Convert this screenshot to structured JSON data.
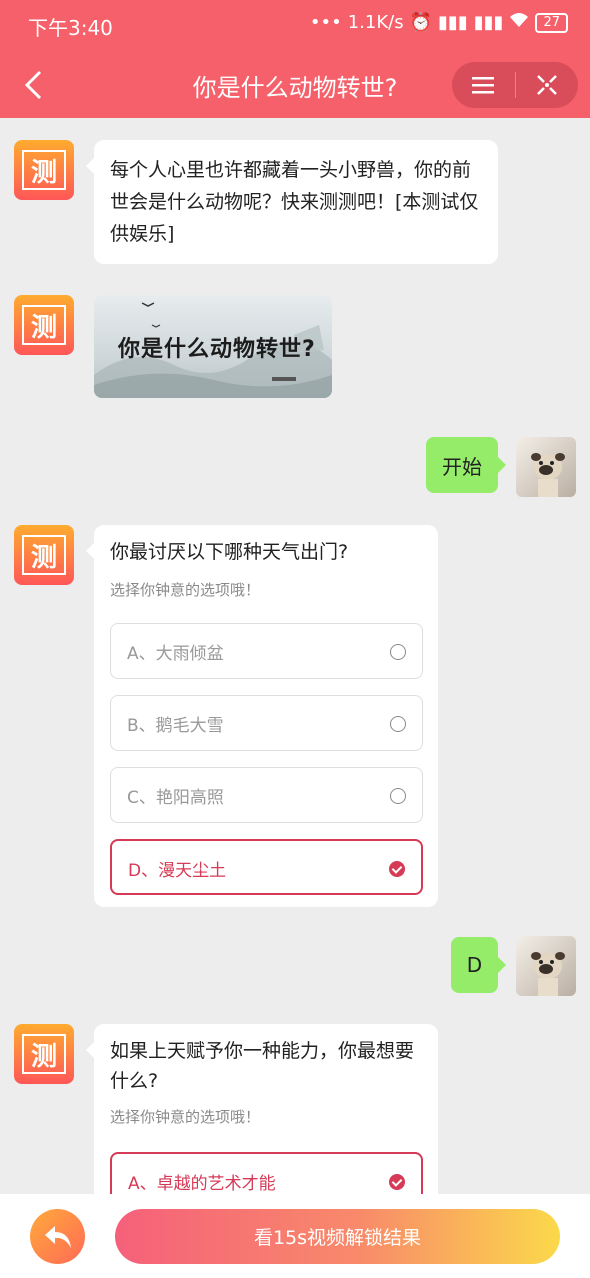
{
  "status_bar": {
    "time": "下午3:40",
    "network_speed": "1.1K/s",
    "battery": "27"
  },
  "header": {
    "title": "你是什么动物转世?",
    "accent_color": "#f5606a"
  },
  "bot": {
    "avatar_char": "测"
  },
  "messages": {
    "intro": "每个人心里也许都藏着一头小野兽，你的前世会是什么动物呢？快来测测吧！[本测试仅供娱乐]",
    "image_caption": "你是什么动物转世?",
    "user_start": "开始",
    "user_answer_1": "D"
  },
  "question1": {
    "text": "你最讨厌以下哪种天气出门?",
    "hint": "选择你钟意的选项哦！",
    "options": [
      "A、大雨倾盆",
      "B、鹅毛大雪",
      "C、艳阳高照",
      "D、漫天尘土"
    ],
    "selected": "D"
  },
  "question2": {
    "text": "如果上天赋予你一种能力，你最想要什么?",
    "hint": "选择你钟意的选项哦！",
    "options": [
      "A、卓越的艺术才能"
    ],
    "selected": "A"
  },
  "footer": {
    "unlock_label": "看15s视频解锁结果"
  }
}
